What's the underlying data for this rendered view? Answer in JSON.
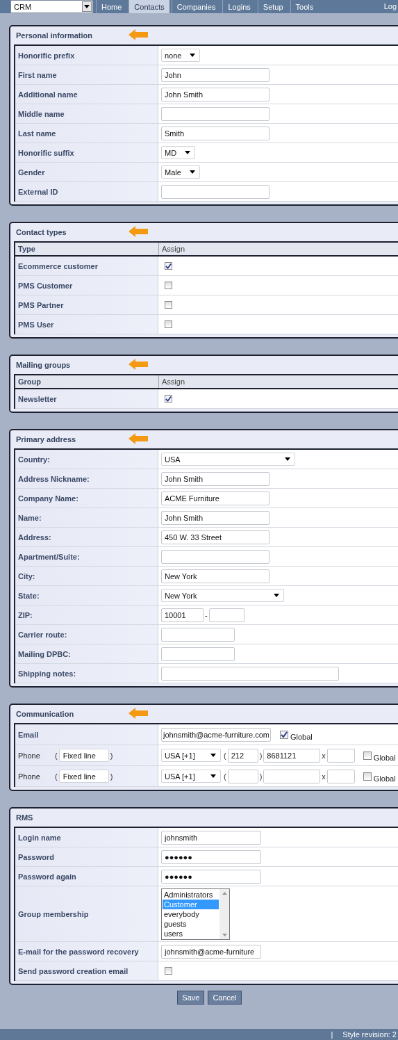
{
  "nav": {
    "app_select": "CRM",
    "tabs": [
      {
        "label": "Home",
        "selected": false
      },
      {
        "label": "Contacts",
        "selected": true
      },
      {
        "label": "Companies",
        "selected": false
      },
      {
        "label": "Logins",
        "selected": false
      },
      {
        "label": "Setup",
        "selected": false
      },
      {
        "label": "Tools",
        "selected": false
      }
    ],
    "right_link": "Log"
  },
  "sections": [
    {
      "title": "Personal information",
      "arrow": true,
      "rows": [
        {
          "kind": "select",
          "label": "Honorific prefix",
          "value": "none"
        },
        {
          "kind": "text",
          "label": "First name",
          "value": "John"
        },
        {
          "kind": "text",
          "label": "Additional name",
          "value": "John Smith"
        },
        {
          "kind": "text",
          "label": "Middle name"
        },
        {
          "kind": "text",
          "label": "Last name",
          "value": "Smith"
        },
        {
          "kind": "select",
          "label": "Honorific suffix",
          "value": "MD"
        },
        {
          "kind": "select",
          "label": "Gender",
          "value": "Male"
        },
        {
          "kind": "text",
          "label": "External ID"
        }
      ]
    },
    {
      "title": "Contact types",
      "arrow": true,
      "columns": [
        "Type",
        "Assign"
      ],
      "rows": [
        {
          "kind": "checkbox",
          "label": "Ecommerce customer",
          "checked": true
        },
        {
          "kind": "checkbox",
          "label": "PMS Customer",
          "checked": false
        },
        {
          "kind": "checkbox",
          "label": "PMS Partner",
          "checked": false
        },
        {
          "kind": "checkbox",
          "label": "PMS User",
          "checked": false
        }
      ]
    },
    {
      "title": "Mailing groups",
      "arrow": true,
      "columns": [
        "Group",
        "Assign"
      ],
      "rows": [
        {
          "kind": "checkbox",
          "label": "Newsletter",
          "checked": true
        }
      ]
    },
    {
      "title": "Primary address",
      "arrow": true,
      "rows": [
        {
          "kind": "longselect",
          "label": "Country:",
          "value": "USA"
        },
        {
          "kind": "text",
          "label": "Address Nickname:",
          "value": "John Smith"
        },
        {
          "kind": "text",
          "label": "Company Name:",
          "value": "ACME Furniture"
        },
        {
          "kind": "text",
          "label": "Name:",
          "value": "John Smith"
        },
        {
          "kind": "text",
          "label": "Address:",
          "value": "450 W. 33 Street"
        },
        {
          "kind": "text",
          "label": "Apartment/Suite:"
        },
        {
          "kind": "text",
          "label": "City:",
          "value": "New York"
        },
        {
          "kind": "midselect",
          "label": "State:",
          "value": "New York"
        },
        {
          "kind": "zip",
          "label": "ZIP:",
          "value": "10001",
          "separator": "-"
        },
        {
          "kind": "shorttext",
          "label": "Carrier route:"
        },
        {
          "kind": "shorttext",
          "label": "Mailing DPBC:"
        },
        {
          "kind": "longtext",
          "label": "Shipping notes:"
        }
      ]
    },
    {
      "title": "Communication",
      "arrow": true,
      "rows": [
        {
          "kind": "email",
          "label": "Email",
          "value": "johnsmith@acme-furniture.com",
          "global": {
            "label": "Global",
            "checked": true
          }
        },
        {
          "kind": "phone",
          "label": "Phone",
          "open": "(",
          "type": "Fixed line",
          "close": ")",
          "country": "USA [+1]",
          "area_open": "(",
          "area": "212",
          "area_close": ")",
          "number": "8681121",
          "ext_separator": "x",
          "global": {
            "label": "Global",
            "checked": false
          }
        },
        {
          "kind": "phone",
          "label": "Phone",
          "open": "(",
          "type": "Fixed line",
          "close": ")",
          "country": "USA [+1]",
          "area_open": "(",
          "area_close": ")",
          "ext_separator": "x",
          "global": {
            "label": "Global",
            "checked": false
          }
        }
      ]
    },
    {
      "title": "RMS",
      "arrow": false,
      "rows": [
        {
          "kind": "mediumtext",
          "label": "Login name",
          "value": "johnsmith"
        },
        {
          "kind": "mediumtext",
          "label": "Password",
          "value": "●●●●●●"
        },
        {
          "kind": "mediumtext",
          "label": "Password again",
          "value": "●●●●●●"
        },
        {
          "kind": "listbox",
          "label": "Group membership",
          "options": [
            {
              "label": "Administrators",
              "selected": false
            },
            {
              "label": "Customer",
              "selected": true
            },
            {
              "label": "everybody",
              "selected": false
            },
            {
              "label": "guests",
              "selected": false
            },
            {
              "label": "users",
              "selected": false
            }
          ]
        },
        {
          "kind": "mediumtext",
          "label": "E-mail for the password recovery",
          "value": "johnsmith@acme-furniture"
        },
        {
          "kind": "checkbox",
          "label": "Send password creation email",
          "checked": false
        }
      ]
    }
  ],
  "buttons": [
    "Save",
    "Cancel"
  ],
  "footer": {
    "separator": "|",
    "text": "Style revision: 2"
  }
}
